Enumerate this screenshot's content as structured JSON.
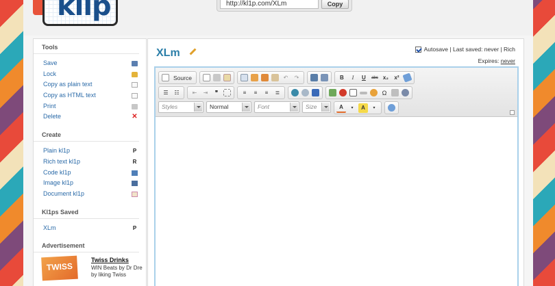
{
  "header": {
    "logo_text": "klip",
    "url": "http://kl1p.com/XLm",
    "copy_label": "Copy"
  },
  "sidebar": {
    "tools": {
      "title": "Tools",
      "items": [
        {
          "label": "Save",
          "icon": "save-icon"
        },
        {
          "label": "Lock",
          "icon": "lock-icon"
        },
        {
          "label": "Copy as plain text",
          "icon": "document-icon"
        },
        {
          "label": "Copy as HTML text",
          "icon": "document-icon"
        },
        {
          "label": "Print",
          "icon": "printer-icon"
        },
        {
          "label": "Delete",
          "icon": "delete-icon",
          "glyph": "✕"
        }
      ]
    },
    "create": {
      "title": "Create",
      "items": [
        {
          "label": "Plain kl1p",
          "glyph": "P"
        },
        {
          "label": "Rich text kl1p",
          "glyph": "R"
        },
        {
          "label": "Code kl1p",
          "icon": "code-icon"
        },
        {
          "label": "Image kl1p",
          "icon": "image-icon"
        },
        {
          "label": "Document kl1p",
          "icon": "document-icon"
        }
      ]
    },
    "saved": {
      "title": "Kl1ps Saved",
      "items": [
        {
          "label": "XLm",
          "glyph": "P"
        }
      ]
    },
    "ad": {
      "title": "Advertisement",
      "image_text": "TWISS",
      "headline": "Twiss Drinks",
      "body": "WIN Beats by Dr Dre by liking Twiss"
    }
  },
  "document": {
    "title": "XLm",
    "autosave_label": "Autosave | Last saved: never | Rich",
    "autosave_checked": true,
    "expires_label": "Expires:",
    "expires_value": "never"
  },
  "editor": {
    "source_label": "Source",
    "bold": "B",
    "italic": "I",
    "underline": "U",
    "strike": "abc",
    "subscript": "x₂",
    "superscript": "x²",
    "styles_placeholder": "Styles",
    "format_value": "Normal",
    "font_placeholder": "Font",
    "size_placeholder": "Size",
    "text_color_glyph": "A",
    "bg_color_glyph": "A",
    "blockquote_glyph": "❞"
  },
  "colors": {
    "link": "#2a6aa8",
    "title": "#2a7ea8",
    "editor_border": "#a9d0ea"
  }
}
